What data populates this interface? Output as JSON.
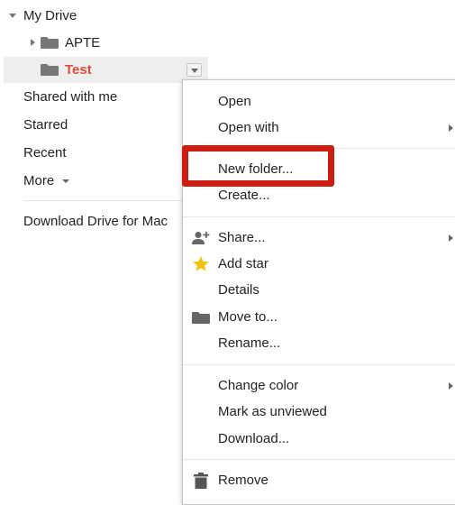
{
  "tree": {
    "root_label": "My Drive",
    "children": [
      {
        "label": "APTE"
      },
      {
        "label": "Test",
        "color": "#dd4b39"
      }
    ]
  },
  "sidebar": {
    "items": [
      {
        "label": "Shared with me"
      },
      {
        "label": "Starred"
      },
      {
        "label": "Recent"
      },
      {
        "label": "More"
      }
    ],
    "download_label": "Download Drive for Mac"
  },
  "context_menu": {
    "groups": [
      [
        {
          "label": "Open",
          "icon": null,
          "submenu": false
        },
        {
          "label": "Open with",
          "icon": null,
          "submenu": true
        }
      ],
      [
        {
          "label": "New folder...",
          "icon": null,
          "submenu": false,
          "highlighted": true
        },
        {
          "label": "Create...",
          "icon": null,
          "submenu": false
        }
      ],
      [
        {
          "label": "Share...",
          "icon": "share-person-icon",
          "submenu": true
        },
        {
          "label": "Add star",
          "icon": "star-icon",
          "submenu": false
        },
        {
          "label": "Details",
          "icon": null,
          "submenu": false
        },
        {
          "label": "Move to...",
          "icon": "folder-icon",
          "submenu": false
        },
        {
          "label": "Rename...",
          "icon": null,
          "submenu": false
        }
      ],
      [
        {
          "label": "Change color",
          "icon": null,
          "submenu": true
        },
        {
          "label": "Mark as unviewed",
          "icon": null,
          "submenu": false
        },
        {
          "label": "Download...",
          "icon": null,
          "submenu": false
        }
      ],
      [
        {
          "label": "Remove",
          "icon": "trash-icon",
          "submenu": false
        }
      ]
    ]
  },
  "colors": {
    "highlight_border": "#cc1d10",
    "selected_folder_text": "#dd4b39",
    "star": "#f4c20d",
    "folder_gray": "#777777"
  }
}
